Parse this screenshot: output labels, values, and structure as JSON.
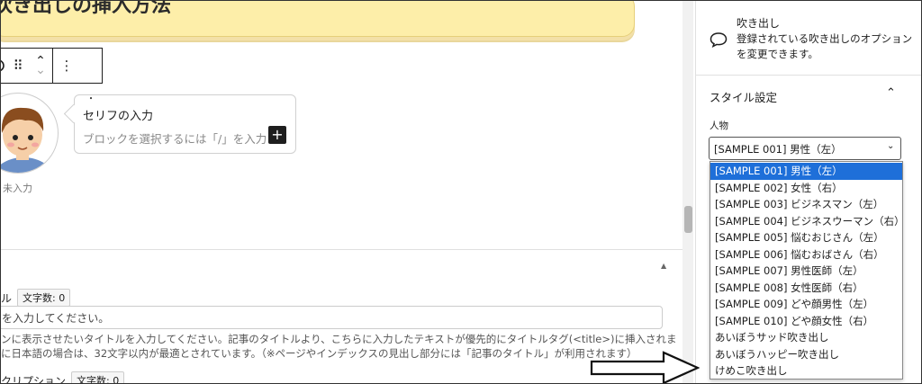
{
  "editor": {
    "heading": "吹き出しの挿入方法",
    "bubble_title": "セリフの入力",
    "bubble_placeholder": "ブロックを選択するには「/」を入力",
    "bubble_dot": "・",
    "avatar_label": "未入力",
    "plus_label": "+",
    "toolbar": {
      "drag_icon": "⠿",
      "up": "⌃",
      "down": "⌄",
      "more": "⋮"
    },
    "meta": {
      "title_label": "ル",
      "title_count": "文字数: 0",
      "title_placeholder": "を入力してください。",
      "help_line1": "ンに表示させたいタイトルを入力してください。記事のタイトルより、こちらに入力したテキストが優先的にタイトルタグ(<title>)に挿入されま",
      "help_line2": "に日本語の場合は、32文字以内が最適とされています。（※ページやインデックスの見出し部分には「記事のタイトル」が利用されます）",
      "desc_label": "クリプション",
      "desc_count": "文字数: 0"
    }
  },
  "sidebar": {
    "block_title": "吹き出し",
    "block_desc": "登録されている吹き出しのオプションを変更できます。",
    "section_title": "スタイル設定",
    "person_label": "人物",
    "selected_value": "[SAMPLE 001] 男性（左）",
    "options": [
      "[SAMPLE 001] 男性（左）",
      "[SAMPLE 002] 女性（右）",
      "[SAMPLE 003] ビジネスマン（左）",
      "[SAMPLE 004] ビジネスウーマン（右）",
      "[SAMPLE 005] 悩むおじさん（左）",
      "[SAMPLE 006] 悩むおばさん（右）",
      "[SAMPLE 007] 男性医師（左）",
      "[SAMPLE 008] 女性医師（右）",
      "[SAMPLE 009] どや顔男性（左）",
      "[SAMPLE 010] どや顔女性（右）",
      "あいぼうサッド吹き出し",
      "あいぼうハッピー吹き出し",
      "けめこ吹き出し"
    ]
  },
  "colors": {
    "heading_bg": "#fdeea9",
    "selected_option": "#1e6fd9"
  }
}
